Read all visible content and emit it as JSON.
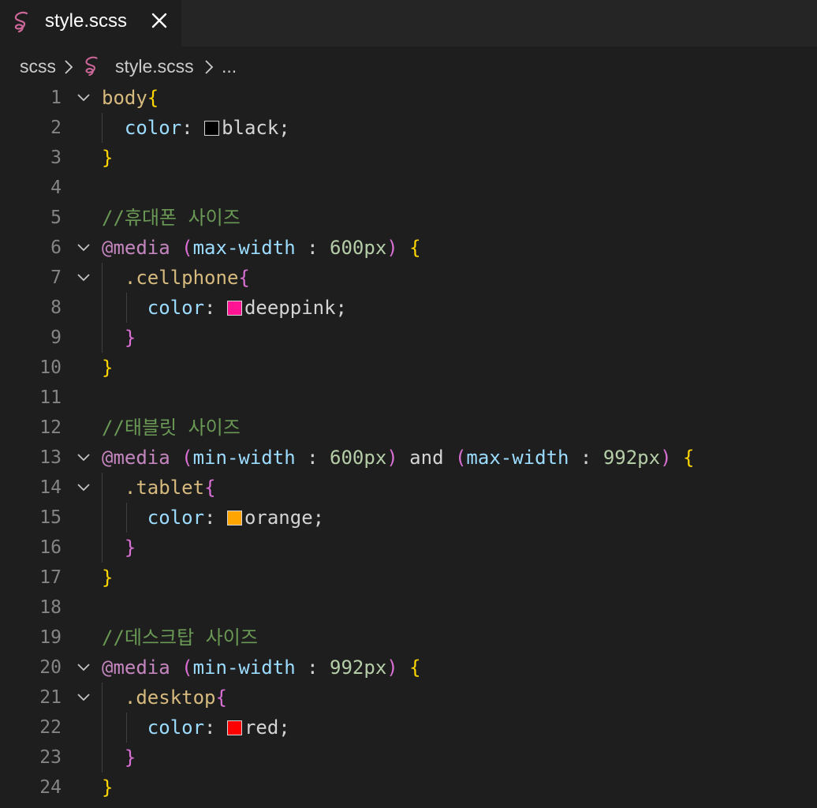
{
  "tab": {
    "title": "style.scss",
    "icon": "sass-icon",
    "close_icon": "close-icon"
  },
  "breadcrumb": {
    "folder": "scss",
    "file": "style.scss",
    "more": "..."
  },
  "colors": {
    "background": "#1e1e1e",
    "tab_bar": "#252526",
    "selector": "#d7ba7d",
    "property": "#9cdcfe",
    "comment": "#6a9955",
    "at_rule": "#c586c0",
    "number": "#b5cea8",
    "brace_level1": "#ffd700",
    "brace_level2": "#da70d6"
  },
  "editor": {
    "lines": [
      {
        "n": "1",
        "fold": true,
        "tokens": [
          [
            "sel",
            "body"
          ],
          [
            "b1",
            "{"
          ]
        ]
      },
      {
        "n": "2",
        "fold": false,
        "tokens": [
          [
            "ind",
            "  "
          ],
          [
            "prop",
            "color"
          ],
          [
            "text",
            ": "
          ],
          [
            "sw",
            "#000000"
          ],
          [
            "text",
            "black;"
          ]
        ]
      },
      {
        "n": "3",
        "fold": false,
        "tokens": [
          [
            "b1",
            "}"
          ]
        ]
      },
      {
        "n": "4",
        "fold": false,
        "tokens": []
      },
      {
        "n": "5",
        "fold": false,
        "tokens": [
          [
            "cmt",
            "//휴대폰 사이즈"
          ]
        ]
      },
      {
        "n": "6",
        "fold": true,
        "tokens": [
          [
            "at",
            "@media"
          ],
          [
            "text",
            " "
          ],
          [
            "b2",
            "("
          ],
          [
            "prop",
            "max-width"
          ],
          [
            "text",
            " : "
          ],
          [
            "num",
            "600px"
          ],
          [
            "b2",
            ")"
          ],
          [
            "text",
            " "
          ],
          [
            "b1",
            "{"
          ]
        ]
      },
      {
        "n": "7",
        "fold": true,
        "tokens": [
          [
            "ind",
            "  "
          ],
          [
            "sel",
            ".cellphone"
          ],
          [
            "b2",
            "{"
          ]
        ]
      },
      {
        "n": "8",
        "fold": false,
        "tokens": [
          [
            "ind",
            "    "
          ],
          [
            "prop",
            "color"
          ],
          [
            "text",
            ": "
          ],
          [
            "sw",
            "#ff1493"
          ],
          [
            "text",
            "deeppink;"
          ]
        ]
      },
      {
        "n": "9",
        "fold": false,
        "tokens": [
          [
            "ind",
            "  "
          ],
          [
            "b2",
            "}"
          ]
        ]
      },
      {
        "n": "10",
        "fold": false,
        "tokens": [
          [
            "b1",
            "}"
          ]
        ]
      },
      {
        "n": "11",
        "fold": false,
        "tokens": []
      },
      {
        "n": "12",
        "fold": false,
        "tokens": [
          [
            "cmt",
            "//태블릿 사이즈"
          ]
        ]
      },
      {
        "n": "13",
        "fold": true,
        "tokens": [
          [
            "at",
            "@media"
          ],
          [
            "text",
            " "
          ],
          [
            "b2",
            "("
          ],
          [
            "prop",
            "min-width"
          ],
          [
            "text",
            " : "
          ],
          [
            "num",
            "600px"
          ],
          [
            "b2",
            ")"
          ],
          [
            "text",
            " and "
          ],
          [
            "b2",
            "("
          ],
          [
            "prop",
            "max-width"
          ],
          [
            "text",
            " : "
          ],
          [
            "num",
            "992px"
          ],
          [
            "b2",
            ")"
          ],
          [
            "text",
            " "
          ],
          [
            "b1",
            "{"
          ]
        ]
      },
      {
        "n": "14",
        "fold": true,
        "tokens": [
          [
            "ind",
            "  "
          ],
          [
            "sel",
            ".tablet"
          ],
          [
            "b2",
            "{"
          ]
        ]
      },
      {
        "n": "15",
        "fold": false,
        "tokens": [
          [
            "ind",
            "    "
          ],
          [
            "prop",
            "color"
          ],
          [
            "text",
            ": "
          ],
          [
            "sw",
            "#ffa500"
          ],
          [
            "text",
            "orange;"
          ]
        ]
      },
      {
        "n": "16",
        "fold": false,
        "tokens": [
          [
            "ind",
            "  "
          ],
          [
            "b2",
            "}"
          ]
        ]
      },
      {
        "n": "17",
        "fold": false,
        "tokens": [
          [
            "b1",
            "}"
          ]
        ]
      },
      {
        "n": "18",
        "fold": false,
        "tokens": []
      },
      {
        "n": "19",
        "fold": false,
        "tokens": [
          [
            "cmt",
            "//데스크탑 사이즈"
          ]
        ]
      },
      {
        "n": "20",
        "fold": true,
        "tokens": [
          [
            "at",
            "@media"
          ],
          [
            "text",
            " "
          ],
          [
            "b2",
            "("
          ],
          [
            "prop",
            "min-width"
          ],
          [
            "text",
            " : "
          ],
          [
            "num",
            "992px"
          ],
          [
            "b2",
            ")"
          ],
          [
            "text",
            " "
          ],
          [
            "b1",
            "{"
          ]
        ]
      },
      {
        "n": "21",
        "fold": true,
        "tokens": [
          [
            "ind",
            "  "
          ],
          [
            "sel",
            ".desktop"
          ],
          [
            "b2",
            "{"
          ]
        ]
      },
      {
        "n": "22",
        "fold": false,
        "tokens": [
          [
            "ind",
            "    "
          ],
          [
            "prop",
            "color"
          ],
          [
            "text",
            ": "
          ],
          [
            "sw",
            "#ff0000"
          ],
          [
            "text",
            "red;"
          ]
        ]
      },
      {
        "n": "23",
        "fold": false,
        "tokens": [
          [
            "ind",
            "  "
          ],
          [
            "b2",
            "}"
          ]
        ]
      },
      {
        "n": "24",
        "fold": false,
        "tokens": [
          [
            "b1",
            "}"
          ]
        ]
      }
    ]
  }
}
